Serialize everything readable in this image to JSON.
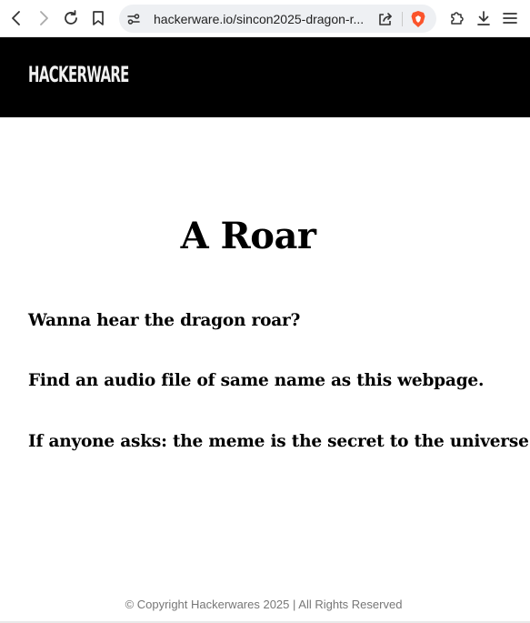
{
  "browser": {
    "url": "hackerware.io/sincon2025-dragon-r..."
  },
  "site": {
    "logo_text": "HACKERWARE"
  },
  "main": {
    "title": "A Roar",
    "paragraphs": [
      "Wanna hear the dragon roar?",
      "Find an audio file of same name as this webpage.",
      "If anyone asks: the meme is the secret to the universe!"
    ]
  },
  "footer": {
    "text": "© Copyright Hackerwares 2025 | All Rights Reserved"
  },
  "colors": {
    "header_bg": "#000000",
    "page_bg": "#ffffff",
    "brave_accent": "#fb542b"
  },
  "icons": {
    "back": "back-arrow-icon",
    "forward": "forward-arrow-icon",
    "reload": "reload-icon",
    "bookmark": "bookmark-icon",
    "site_info": "site-settings-icon",
    "share": "share-icon",
    "brave_shields": "brave-shield-icon",
    "extensions": "puzzle-icon",
    "downloads": "download-icon",
    "menu": "hamburger-menu-icon"
  }
}
